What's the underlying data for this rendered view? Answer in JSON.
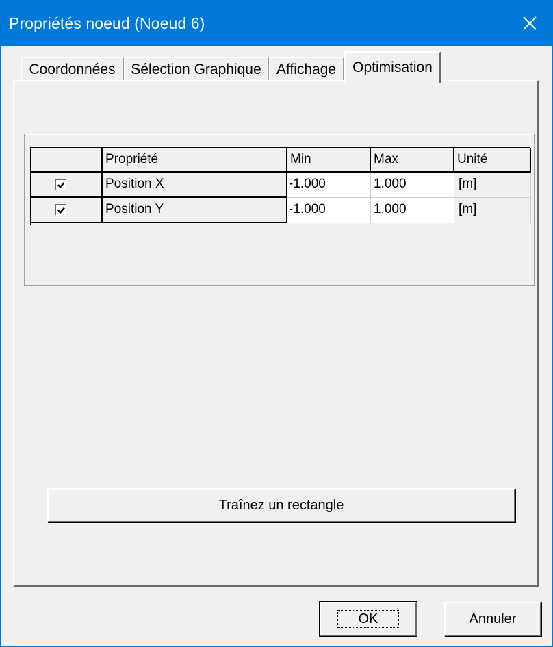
{
  "window": {
    "title": "Propriétés noeud (Noeud 6)",
    "accent": "#0078d7"
  },
  "tabs": [
    {
      "label": "Coordonnées",
      "active": false
    },
    {
      "label": "Sélection Graphique",
      "active": false
    },
    {
      "label": "Affichage",
      "active": false
    },
    {
      "label": "Optimisation",
      "active": true
    }
  ],
  "table": {
    "headers": [
      "",
      "Propriété",
      "Min",
      "Max",
      "Unité"
    ],
    "rows": [
      {
        "checked": true,
        "property": "Position X",
        "min": "-1.000",
        "max": "1.000",
        "unit": "[m]"
      },
      {
        "checked": true,
        "property": "Position Y",
        "min": "-1.000",
        "max": "1.000",
        "unit": "[m]"
      }
    ]
  },
  "buttons": {
    "drag_rect": "Traînez un rectangle",
    "ok": "OK",
    "cancel": "Annuler"
  }
}
